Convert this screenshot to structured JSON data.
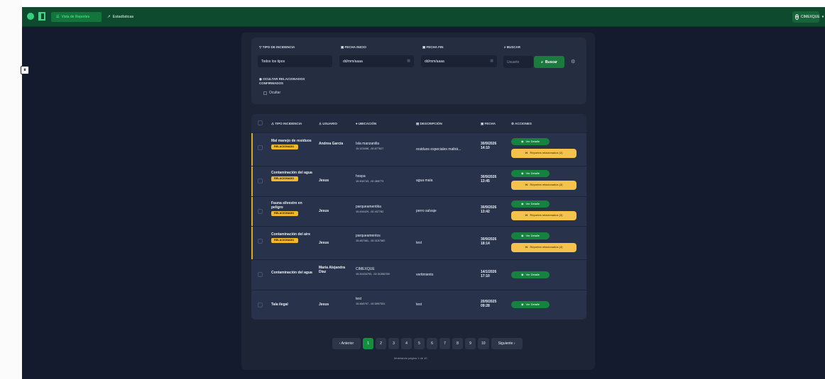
{
  "topbar": {
    "nav_active": "Vista de Reportes",
    "nav_stats": "Estadísticas",
    "user": "CIMEXQUE"
  },
  "filters": {
    "incident_type_label": "TIPO DE INCIDENCIA",
    "incident_type_value": "Todos los tipos",
    "start_date_label": "FECHA INICIO",
    "start_date_placeholder": "dd/mm/aaaa",
    "end_date_label": "FECHA FIN",
    "end_date_placeholder": "dd/mm/aaaa",
    "search_label": "BUSCAR",
    "search_placeholder": "Usuario",
    "search_button": "Buscar",
    "related_label": "OCULTAR RELACIONADOS CONFIRMADOS",
    "hide_label": "Ocultar"
  },
  "table": {
    "headers": [
      "TIPO INCIDENCIA",
      "USUARIO",
      "UBICACIÓN",
      "DESCRIPCIÓN",
      "FECHA",
      "ACCIONES"
    ],
    "rows": [
      {
        "incident": "Mal manejo de residuos",
        "badge": "RELACIONADO",
        "user": "Andrea García",
        "location": "Isla manzanilla",
        "coordinates": "15.123498, -92.877627",
        "description": "residuos especiales maltrá...",
        "date": "30/9/2026 14:10",
        "view": "Ver Detalle",
        "related": "Reportes relacionados (2)"
      },
      {
        "incident": "Contaminación del agua",
        "badge": "RELACIONADO",
        "user": "Jesus",
        "location": "hospa",
        "coordinates": "15.494743, -92.465773",
        "description": "agua mala",
        "date": "30/9/2026 13:45",
        "view": "Ver Detalle",
        "related": "Reportes relacionados (3)"
      },
      {
        "incident": "Fauna silvestre en peligro",
        "badge": "RELACIONADO",
        "user": "Jesus",
        "location": "parqueamentika",
        "coordinates": "15.494429, -92.437782",
        "description": "perro salvaje",
        "date": "30/9/2026 13:42",
        "view": "Ver Detalle",
        "related": "Reportes relacionados (3)"
      },
      {
        "incident": "Contaminación del aire",
        "badge": "RELACIONADO",
        "user": "Jesus",
        "location": "parqueamentos",
        "coordinates": "15.487361, -92.3157382",
        "description": "test",
        "date": "30/9/2026 18:14",
        "view": "Ver Detalle",
        "related": "Reportes relacionados (4)"
      },
      {
        "incident": "Contaminación del agua",
        "badge": "",
        "user": "María Alejandra Díaz",
        "location": "CIMEXQUE",
        "coordinates": "15.32434793, -92.31356789",
        "description": "vertimiento",
        "date": "14/1/2026 17:10",
        "view": "Ver Detalle",
        "related": ""
      },
      {
        "incident": "Tala ilegal",
        "badge": "",
        "user": "Jesus",
        "location": "test",
        "coordinates": "15.466797, -92.5997331",
        "description": "test",
        "date": "20/9/2025 09:28",
        "view": "Ver Detalle",
        "related": ""
      }
    ]
  },
  "pagination": {
    "previous": "‹ Anterior",
    "next": "Siguiente ›",
    "pages": [
      "1",
      "2",
      "3",
      "4",
      "5",
      "6",
      "7",
      "8",
      "9",
      "10"
    ],
    "caption": "Mostrando página 1 de 10"
  },
  "edge_button": "⏸",
  "colors": {
    "top_bar": "#0e4a2e",
    "background": "#151b2e",
    "card": "#252d40",
    "accent_green": "#16823f",
    "accent_yellow": "#f5c24b"
  }
}
